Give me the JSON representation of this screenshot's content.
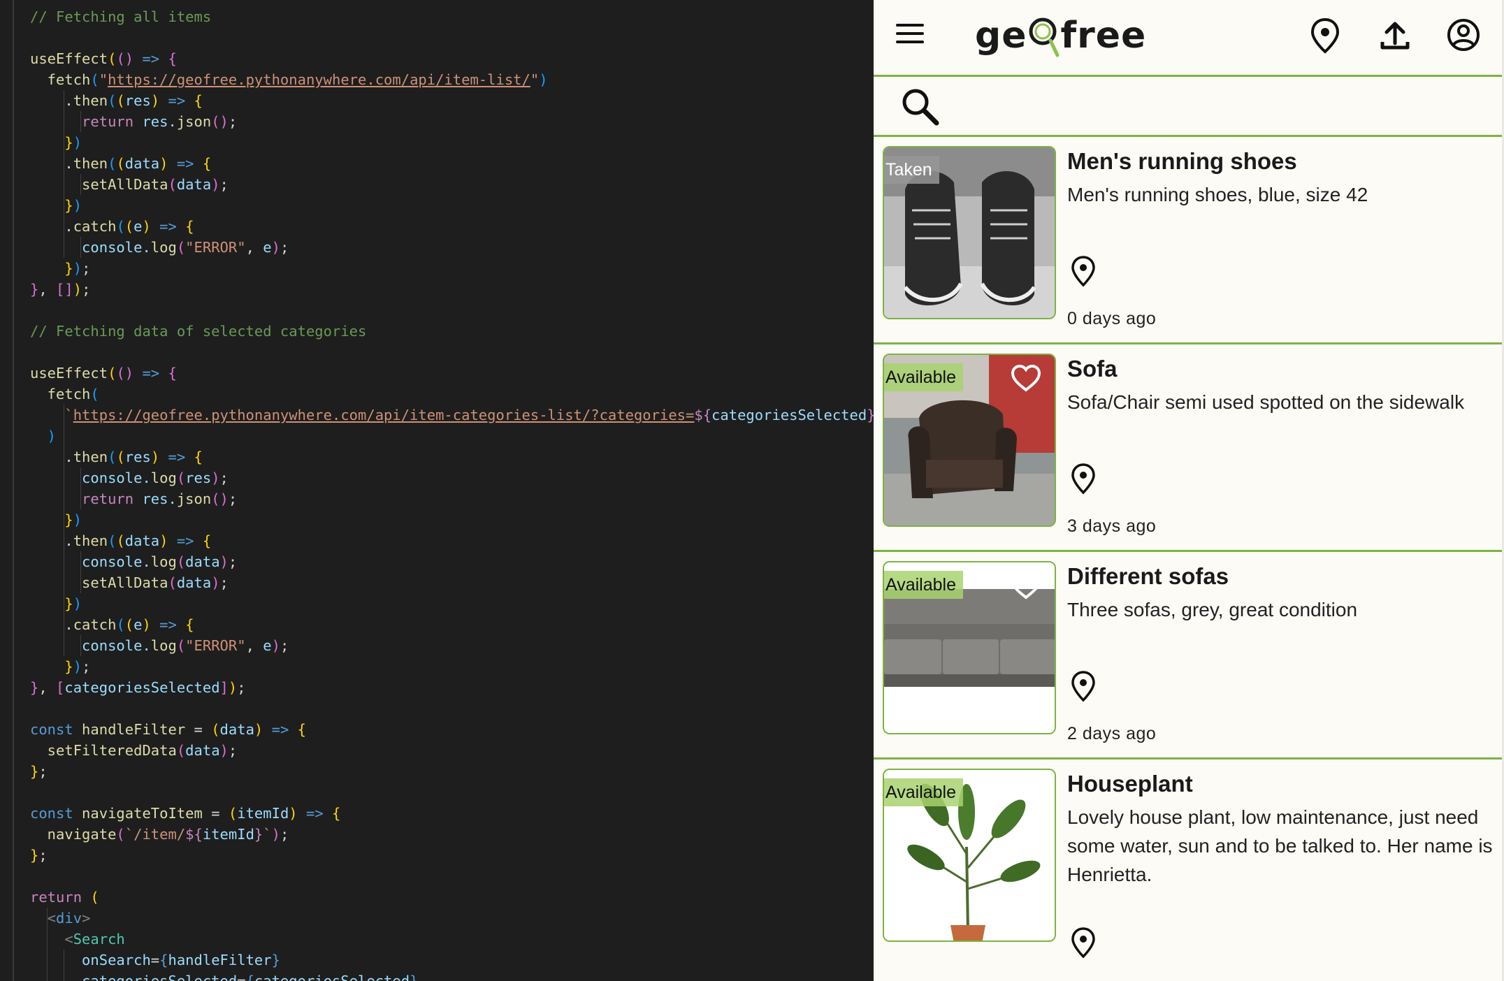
{
  "editor": {
    "lines": [
      [
        {
          "t": "// Fetching all items",
          "c": "com"
        }
      ],
      [],
      [
        {
          "t": "useEffect",
          "c": "fn"
        },
        {
          "t": "(",
          "c": "p"
        },
        {
          "t": "()",
          "c": "p2"
        },
        {
          "t": " => ",
          "c": "kw"
        },
        {
          "t": "{",
          "c": "p2"
        }
      ],
      [
        {
          "t": "  fetch",
          "c": "fn"
        },
        {
          "t": "(",
          "c": "p3"
        },
        {
          "t": "\"",
          "c": "str"
        },
        {
          "t": "https://geofree.pythonanywhere.com/api/item-list/",
          "c": "url"
        },
        {
          "t": "\"",
          "c": "str"
        },
        {
          "t": ")",
          "c": "p3"
        }
      ],
      [
        {
          "t": "    .",
          "c": ""
        },
        {
          "t": "then",
          "c": "fn"
        },
        {
          "t": "(",
          "c": "p3"
        },
        {
          "t": "(",
          "c": "p"
        },
        {
          "t": "res",
          "c": "var"
        },
        {
          "t": ")",
          "c": "p"
        },
        {
          "t": " => ",
          "c": "kw"
        },
        {
          "t": "{",
          "c": "p"
        }
      ],
      [
        {
          "t": "      return",
          "c": "ctl"
        },
        {
          "t": " res.",
          "c": "var"
        },
        {
          "t": "json",
          "c": "fn"
        },
        {
          "t": "()",
          "c": "p2"
        },
        {
          "t": ";",
          "c": ""
        }
      ],
      [
        {
          "t": "    }",
          "c": "p"
        },
        {
          "t": ")",
          "c": "p3"
        }
      ],
      [
        {
          "t": "    .",
          "c": ""
        },
        {
          "t": "then",
          "c": "fn"
        },
        {
          "t": "(",
          "c": "p3"
        },
        {
          "t": "(",
          "c": "p"
        },
        {
          "t": "data",
          "c": "var"
        },
        {
          "t": ")",
          "c": "p"
        },
        {
          "t": " => ",
          "c": "kw"
        },
        {
          "t": "{",
          "c": "p"
        }
      ],
      [
        {
          "t": "      setAllData",
          "c": "fn"
        },
        {
          "t": "(",
          "c": "p2"
        },
        {
          "t": "data",
          "c": "var"
        },
        {
          "t": ")",
          "c": "p2"
        },
        {
          "t": ";",
          "c": ""
        }
      ],
      [
        {
          "t": "    }",
          "c": "p"
        },
        {
          "t": ")",
          "c": "p3"
        }
      ],
      [
        {
          "t": "    .",
          "c": ""
        },
        {
          "t": "catch",
          "c": "fn"
        },
        {
          "t": "(",
          "c": "p3"
        },
        {
          "t": "(",
          "c": "p"
        },
        {
          "t": "e",
          "c": "var"
        },
        {
          "t": ")",
          "c": "p"
        },
        {
          "t": " => ",
          "c": "kw"
        },
        {
          "t": "{",
          "c": "p"
        }
      ],
      [
        {
          "t": "      console.",
          "c": "var"
        },
        {
          "t": "log",
          "c": "fn"
        },
        {
          "t": "(",
          "c": "p2"
        },
        {
          "t": "\"ERROR\"",
          "c": "str"
        },
        {
          "t": ", ",
          "c": ""
        },
        {
          "t": "e",
          "c": "var"
        },
        {
          "t": ")",
          "c": "p2"
        },
        {
          "t": ";",
          "c": ""
        }
      ],
      [
        {
          "t": "    }",
          "c": "p"
        },
        {
          "t": ")",
          "c": "p3"
        },
        {
          "t": ";",
          "c": ""
        }
      ],
      [
        {
          "t": "}",
          "c": "p2"
        },
        {
          "t": ", ",
          "c": ""
        },
        {
          "t": "[]",
          "c": "p2"
        },
        {
          "t": ")",
          "c": "p"
        },
        {
          "t": ";",
          "c": ""
        }
      ],
      [],
      [
        {
          "t": "// Fetching data of selected categories",
          "c": "com"
        }
      ],
      [],
      [
        {
          "t": "useEffect",
          "c": "fn"
        },
        {
          "t": "(",
          "c": "p"
        },
        {
          "t": "()",
          "c": "p2"
        },
        {
          "t": " => ",
          "c": "kw"
        },
        {
          "t": "{",
          "c": "p2"
        }
      ],
      [
        {
          "t": "  fetch",
          "c": "fn"
        },
        {
          "t": "(",
          "c": "p3"
        }
      ],
      [
        {
          "t": "    `",
          "c": "str"
        },
        {
          "t": "https://geofree.pythonanywhere.com/api/item-categories-list/?categories=",
          "c": "url"
        },
        {
          "t": "${",
          "c": "ctl"
        },
        {
          "t": "categoriesSelected",
          "c": "var"
        },
        {
          "t": "}",
          "c": "ctl"
        },
        {
          "t": "`",
          "c": "str"
        }
      ],
      [
        {
          "t": "  )",
          "c": "p3"
        }
      ],
      [
        {
          "t": "    .",
          "c": ""
        },
        {
          "t": "then",
          "c": "fn"
        },
        {
          "t": "(",
          "c": "p3"
        },
        {
          "t": "(",
          "c": "p"
        },
        {
          "t": "res",
          "c": "var"
        },
        {
          "t": ")",
          "c": "p"
        },
        {
          "t": " => ",
          "c": "kw"
        },
        {
          "t": "{",
          "c": "p"
        }
      ],
      [
        {
          "t": "      console.",
          "c": "var"
        },
        {
          "t": "log",
          "c": "fn"
        },
        {
          "t": "(",
          "c": "p2"
        },
        {
          "t": "res",
          "c": "var"
        },
        {
          "t": ")",
          "c": "p2"
        },
        {
          "t": ";",
          "c": ""
        }
      ],
      [
        {
          "t": "      return",
          "c": "ctl"
        },
        {
          "t": " res.",
          "c": "var"
        },
        {
          "t": "json",
          "c": "fn"
        },
        {
          "t": "()",
          "c": "p2"
        },
        {
          "t": ";",
          "c": ""
        }
      ],
      [
        {
          "t": "    }",
          "c": "p"
        },
        {
          "t": ")",
          "c": "p3"
        }
      ],
      [
        {
          "t": "    .",
          "c": ""
        },
        {
          "t": "then",
          "c": "fn"
        },
        {
          "t": "(",
          "c": "p3"
        },
        {
          "t": "(",
          "c": "p"
        },
        {
          "t": "data",
          "c": "var"
        },
        {
          "t": ")",
          "c": "p"
        },
        {
          "t": " => ",
          "c": "kw"
        },
        {
          "t": "{",
          "c": "p"
        }
      ],
      [
        {
          "t": "      console.",
          "c": "var"
        },
        {
          "t": "log",
          "c": "fn"
        },
        {
          "t": "(",
          "c": "p2"
        },
        {
          "t": "data",
          "c": "var"
        },
        {
          "t": ")",
          "c": "p2"
        },
        {
          "t": ";",
          "c": ""
        }
      ],
      [
        {
          "t": "      setAllData",
          "c": "fn"
        },
        {
          "t": "(",
          "c": "p2"
        },
        {
          "t": "data",
          "c": "var"
        },
        {
          "t": ")",
          "c": "p2"
        },
        {
          "t": ";",
          "c": ""
        }
      ],
      [
        {
          "t": "    }",
          "c": "p"
        },
        {
          "t": ")",
          "c": "p3"
        }
      ],
      [
        {
          "t": "    .",
          "c": ""
        },
        {
          "t": "catch",
          "c": "fn"
        },
        {
          "t": "(",
          "c": "p3"
        },
        {
          "t": "(",
          "c": "p"
        },
        {
          "t": "e",
          "c": "var"
        },
        {
          "t": ")",
          "c": "p"
        },
        {
          "t": " => ",
          "c": "kw"
        },
        {
          "t": "{",
          "c": "p"
        }
      ],
      [
        {
          "t": "      console.",
          "c": "var"
        },
        {
          "t": "log",
          "c": "fn"
        },
        {
          "t": "(",
          "c": "p2"
        },
        {
          "t": "\"ERROR\"",
          "c": "str"
        },
        {
          "t": ", ",
          "c": ""
        },
        {
          "t": "e",
          "c": "var"
        },
        {
          "t": ")",
          "c": "p2"
        },
        {
          "t": ";",
          "c": ""
        }
      ],
      [
        {
          "t": "    }",
          "c": "p"
        },
        {
          "t": ")",
          "c": "p3"
        },
        {
          "t": ";",
          "c": ""
        }
      ],
      [
        {
          "t": "}",
          "c": "p2"
        },
        {
          "t": ", ",
          "c": ""
        },
        {
          "t": "[",
          "c": "p2"
        },
        {
          "t": "categoriesSelected",
          "c": "var"
        },
        {
          "t": "]",
          "c": "p2"
        },
        {
          "t": ")",
          "c": "p"
        },
        {
          "t": ";",
          "c": ""
        }
      ],
      [],
      [
        {
          "t": "const",
          "c": "kw"
        },
        {
          "t": " handleFilter",
          "c": "fn"
        },
        {
          "t": " = ",
          "c": ""
        },
        {
          "t": "(",
          "c": "p"
        },
        {
          "t": "data",
          "c": "var"
        },
        {
          "t": ")",
          "c": "p"
        },
        {
          "t": " => ",
          "c": "kw"
        },
        {
          "t": "{",
          "c": "p"
        }
      ],
      [
        {
          "t": "  setFilteredData",
          "c": "fn"
        },
        {
          "t": "(",
          "c": "p2"
        },
        {
          "t": "data",
          "c": "var"
        },
        {
          "t": ")",
          "c": "p2"
        },
        {
          "t": ";",
          "c": ""
        }
      ],
      [
        {
          "t": "}",
          "c": "p"
        },
        {
          "t": ";",
          "c": ""
        }
      ],
      [],
      [
        {
          "t": "const",
          "c": "kw"
        },
        {
          "t": " navigateToItem",
          "c": "fn"
        },
        {
          "t": " = ",
          "c": ""
        },
        {
          "t": "(",
          "c": "p"
        },
        {
          "t": "itemId",
          "c": "var"
        },
        {
          "t": ")",
          "c": "p"
        },
        {
          "t": " => ",
          "c": "kw"
        },
        {
          "t": "{",
          "c": "p"
        }
      ],
      [
        {
          "t": "  navigate",
          "c": "fn"
        },
        {
          "t": "(",
          "c": "p2"
        },
        {
          "t": "`/item/",
          "c": "str"
        },
        {
          "t": "${",
          "c": "ctl"
        },
        {
          "t": "itemId",
          "c": "var"
        },
        {
          "t": "}",
          "c": "ctl"
        },
        {
          "t": "`",
          "c": "str"
        },
        {
          "t": ")",
          "c": "p2"
        },
        {
          "t": ";",
          "c": ""
        }
      ],
      [
        {
          "t": "}",
          "c": "p"
        },
        {
          "t": ";",
          "c": ""
        }
      ],
      [],
      [
        {
          "t": "return",
          "c": "ctl"
        },
        {
          "t": " (",
          "c": "p"
        }
      ],
      [
        {
          "t": "  <",
          "c": "punc"
        },
        {
          "t": "div",
          "c": "tag"
        },
        {
          "t": ">",
          "c": "punc"
        }
      ],
      [
        {
          "t": "    <",
          "c": "punc"
        },
        {
          "t": "Search",
          "c": "comp"
        }
      ],
      [
        {
          "t": "      onSearch",
          "c": "var"
        },
        {
          "t": "=",
          "c": ""
        },
        {
          "t": "{",
          "c": "kw"
        },
        {
          "t": "handleFilter",
          "c": "var"
        },
        {
          "t": "}",
          "c": "kw"
        }
      ],
      [
        {
          "t": "      categoriesSelected",
          "c": "var"
        },
        {
          "t": "=",
          "c": ""
        },
        {
          "t": "{",
          "c": "kw"
        },
        {
          "t": "categoriesSelected",
          "c": "var"
        },
        {
          "t": "}",
          "c": "kw"
        }
      ]
    ]
  },
  "app": {
    "logo": {
      "part1": "ge",
      "part2": "free"
    },
    "colors": {
      "accent": "#7cb342",
      "available_badge": "#a8d26e",
      "taken_badge": "#969696",
      "background": "#fcfbf6"
    },
    "header_icons": [
      "menu-icon",
      "map-pin-icon",
      "upload-icon",
      "account-icon"
    ],
    "search": {
      "placeholder": "",
      "value": ""
    },
    "items": [
      {
        "status": "Taken",
        "title": "Men's running shoes",
        "description": "Men's running shoes, blue, size 42",
        "age": "0 days ago",
        "image": "shoes-photo"
      },
      {
        "status": "Available",
        "title": "Sofa",
        "description": "Sofa/Chair semi used spotted on the sidewalk",
        "age": "3 days ago",
        "image": "armchair-photo"
      },
      {
        "status": "Available",
        "title": "Different sofas",
        "description": "Three sofas, grey, great condition",
        "age": "2 days ago",
        "image": "grey-sofa-photo"
      },
      {
        "status": "Available",
        "title": "Houseplant",
        "description": "Lovely house plant, low maintenance, just need some water, sun and to be talked to. Her name is Henrietta.",
        "age": "",
        "image": "houseplant-photo"
      }
    ]
  }
}
